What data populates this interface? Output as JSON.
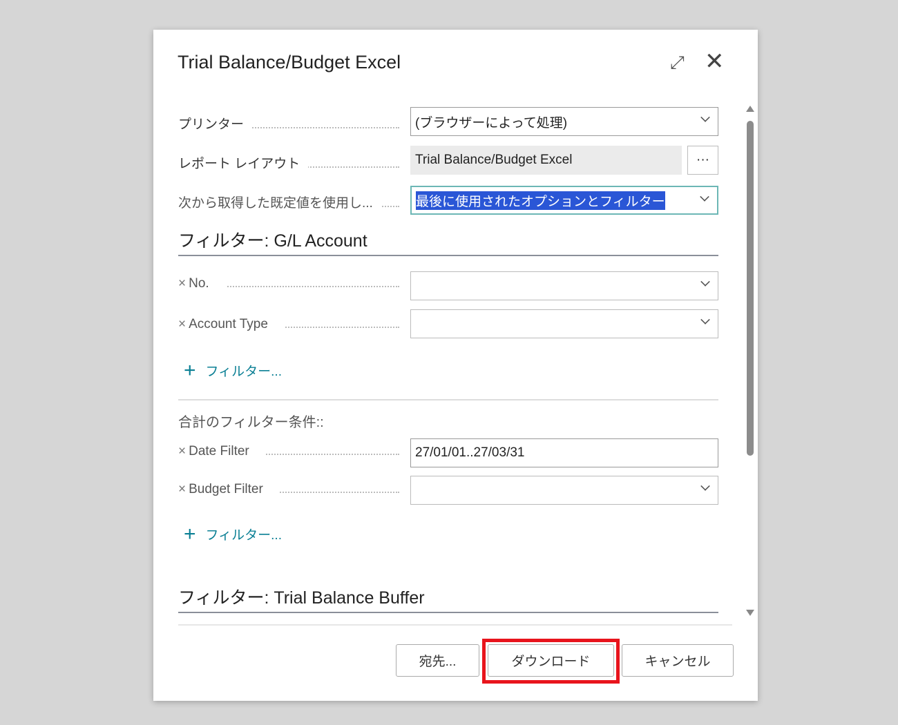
{
  "dialog": {
    "title": "Trial Balance/Budget Excel"
  },
  "options": {
    "printer": {
      "label": "プリンター",
      "value": "(ブラウザーによって処理)"
    },
    "layout": {
      "label": "レポート レイアウト",
      "value": "Trial Balance/Budget Excel",
      "button": "···"
    },
    "defaults": {
      "label": "次から取得した既定値を使用し...",
      "value": "最後に使用されたオプションとフィルター"
    }
  },
  "gl_filter": {
    "heading": "フィルター: G/L Account",
    "fields": [
      {
        "label": "No.",
        "value": ""
      },
      {
        "label": "Account Type",
        "value": ""
      }
    ],
    "add": "フィルター..."
  },
  "totals_filter": {
    "heading": "合計のフィルター条件::",
    "fields": [
      {
        "label": "Date Filter",
        "value": "27/01/01..27/03/31"
      },
      {
        "label": "Budget Filter",
        "value": ""
      }
    ],
    "add": "フィルター..."
  },
  "tb_filter": {
    "heading": "フィルター: Trial Balance Buffer"
  },
  "buttons": {
    "send_to": "宛先...",
    "download": "ダウンロード",
    "cancel": "キャンセル"
  },
  "highlight_color": "#e8141c"
}
